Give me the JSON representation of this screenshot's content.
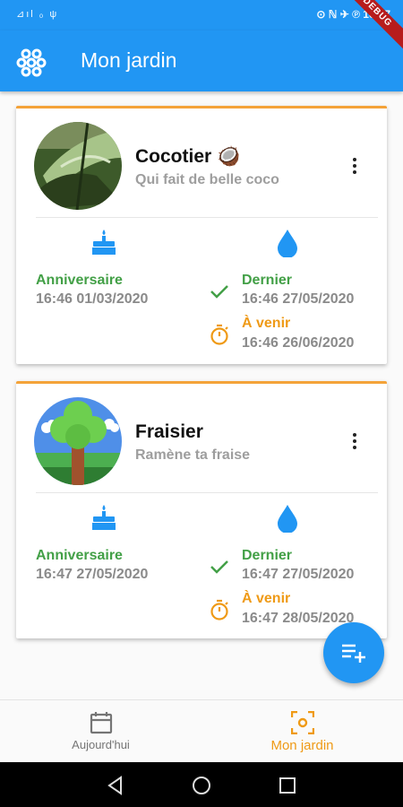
{
  "status_bar": {
    "left": "⊿ıl  ₀  ψ",
    "right": "⊙ ℕ ✈ ℗ 16:47"
  },
  "debug_badge": "DEBUG",
  "app_bar": {
    "title": "Mon jardin",
    "menu_icon": "flower-icon"
  },
  "plants": [
    {
      "name": "Cocotier 🥥",
      "subtitle": "Qui fait de belle coco",
      "anniversary_label": "Anniversaire",
      "anniversary_date": "16:46 01/03/2020",
      "last_label": "Dernier",
      "last_date": "16:46 27/05/2020",
      "next_label": "À venir",
      "next_date": "16:46 26/06/2020"
    },
    {
      "name": "Fraisier",
      "subtitle": "Ramène ta fraise",
      "anniversary_label": "Anniversaire",
      "anniversary_date": "16:47 27/05/2020",
      "last_label": "Dernier",
      "last_date": "16:47 27/05/2020",
      "next_label": "À venir",
      "next_date": "16:47 28/05/2020"
    }
  ],
  "bottom_nav": [
    {
      "label": "Aujourd'hui",
      "icon": "calendar-icon",
      "active": false
    },
    {
      "label": "Mon jardin",
      "icon": "scan-icon",
      "active": true
    }
  ],
  "colors": {
    "primary": "#2196f3",
    "accent": "#ef9a16",
    "green": "#43a047"
  }
}
